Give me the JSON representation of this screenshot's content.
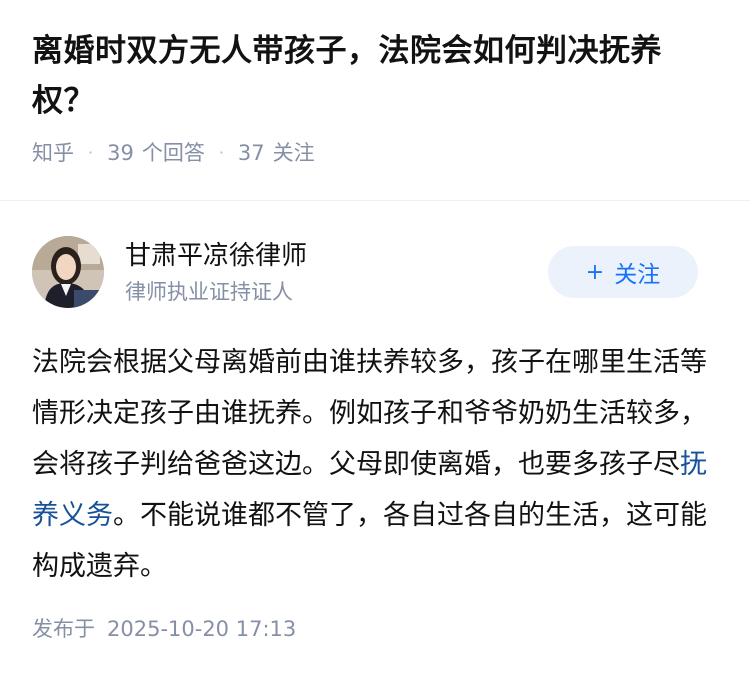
{
  "question": {
    "title": "离婚时双方无人带孩子，法院会如何判决抚养权？",
    "source": "知乎",
    "answers_count": "39",
    "answers_label": "个回答",
    "followers_count": "37",
    "followers_label": "关注",
    "separator": "·"
  },
  "author": {
    "name": "甘肃平凉徐律师",
    "description": "律师执业证持证人",
    "follow_icon": "+",
    "follow_label": "关注"
  },
  "answer": {
    "text_before_link": "法院会根据父母离婚前由谁扶养较多，孩子在哪里生活等情形决定孩子由谁抚养。例如孩子和爷爷奶奶生活较多，会将孩子判给爸爸这边。父母即使离婚，也要多孩子尽",
    "link_text": "抚养义务",
    "text_after_link": "。不能说谁都不管了，各自过各自的生活，这可能构成遗弃。"
  },
  "publish": {
    "label": "发布于",
    "datetime": "2025-10-20 17:13"
  },
  "colors": {
    "meta_gray": "#8590a6",
    "link_blue": "#175199",
    "follow_blue": "#1772f6",
    "follow_bg": "#ebf2fb"
  }
}
